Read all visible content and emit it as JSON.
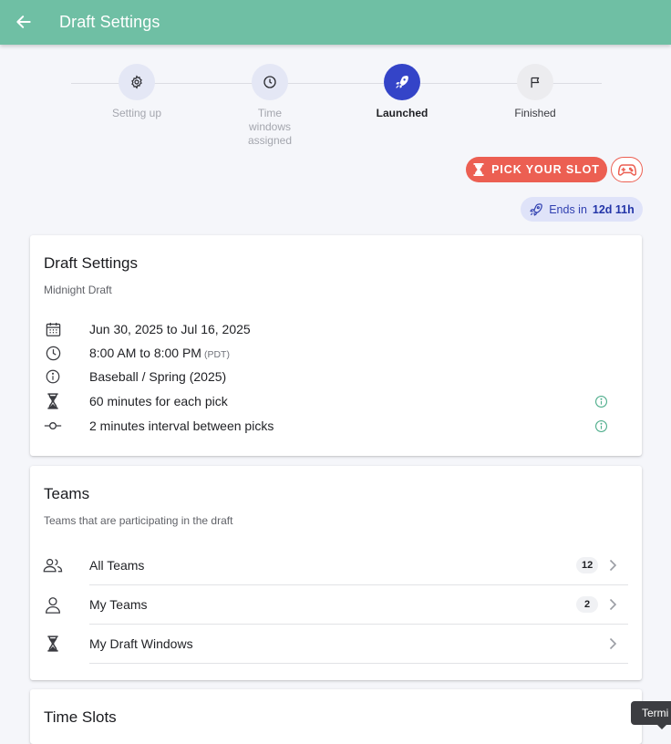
{
  "appbar": {
    "title": "Draft Settings",
    "color": "#6fbfa4"
  },
  "stepper": {
    "steps": [
      {
        "label": "Setting up",
        "icon": "gear-icon",
        "state": "done"
      },
      {
        "label": "Time windows assigned",
        "icon": "clock-icon",
        "state": "done"
      },
      {
        "label": "Launched",
        "icon": "rocket-icon",
        "state": "active"
      },
      {
        "label": "Finished",
        "icon": "flag-icon",
        "state": "pending"
      }
    ]
  },
  "actions": {
    "pick_slot_label": "PICK YOUR SLOT",
    "pick_slot_color": "#ec5f52",
    "ends_prefix": "Ends in",
    "ends_value": "12d 11h"
  },
  "settings_card": {
    "title": "Draft Settings",
    "subtitle": "Midnight Draft",
    "rows": [
      {
        "icon": "calendar-icon",
        "text": "Jun 30, 2025 to Jul 16, 2025"
      },
      {
        "icon": "clock-icon",
        "text": "8:00 AM to 8:00 PM",
        "suffix": "(PDT)"
      },
      {
        "icon": "info-circle-icon",
        "text": "Baseball / Spring (2025)"
      },
      {
        "icon": "hourglass-icon",
        "text": "60 minutes for each pick",
        "has_info": true
      },
      {
        "icon": "interval-icon",
        "text": "2 minutes interval between picks",
        "has_info": true
      }
    ]
  },
  "teams_card": {
    "title": "Teams",
    "subtitle": "Teams that are participating in the draft",
    "items": [
      {
        "icon": "group-icon",
        "label": "All Teams",
        "count": "12"
      },
      {
        "icon": "person-icon",
        "label": "My Teams",
        "count": "2"
      },
      {
        "icon": "hourglass-icon",
        "label": "My Draft Windows",
        "count": ""
      }
    ]
  },
  "time_slots_card": {
    "title": "Time Slots"
  },
  "tooltip": {
    "text": "Termi"
  }
}
